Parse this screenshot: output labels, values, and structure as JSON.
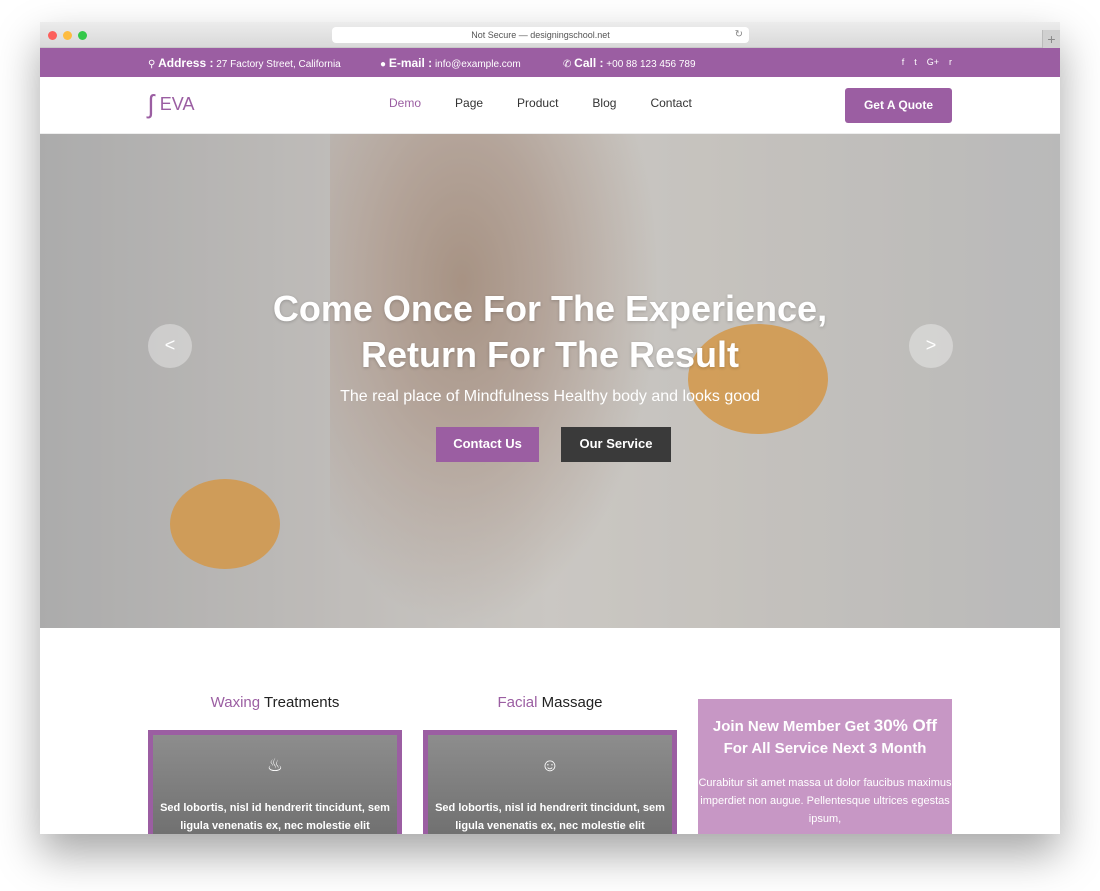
{
  "browser": {
    "url": "Not Secure — designingschool.net"
  },
  "topbar": {
    "address_label": "Address :",
    "address": "27 Factory Street, California",
    "email_label": "E-mail :",
    "email": "info@example.com",
    "call_label": "Call :",
    "call": "+00 88 123 456 789",
    "social": [
      "f",
      "t",
      "G+",
      "r"
    ]
  },
  "nav": {
    "logo": "EVA",
    "items": [
      "Demo",
      "Page",
      "Product",
      "Blog",
      "Contact"
    ],
    "active": "Demo",
    "cta": "Get A Quote"
  },
  "hero": {
    "title_line1": "Come Once For The Experience,",
    "title_line2": "Return For The Result",
    "subtitle": "The real place of Mindfulness Healthy body and looks good",
    "btn_primary": "Contact Us",
    "btn_secondary": "Our Service",
    "prev": "<",
    "next": ">"
  },
  "services": [
    {
      "accent": "Waxing",
      "rest": " Treatments",
      "text": "Sed lobortis, nisl id hendrerit tincidunt, sem ligula venenatis ex, nec molestie elit"
    },
    {
      "accent": "Facial",
      "rest": " Massage",
      "text": "Sed lobortis, nisl id hendrerit tincidunt, sem ligula venenatis ex, nec molestie elit"
    }
  ],
  "promo": {
    "title_a": "Join New Member Get ",
    "title_big": "30% Off",
    "title_b": "For All Service Next 3 Month",
    "text": "Curabitur sit amet massa ut dolor faucibus maximus imperdiet non augue. Pellentesque ultrices egestas ipsum,"
  },
  "colors": {
    "brand": "#9b5ea2",
    "dark_button": "#3a3a3a"
  }
}
